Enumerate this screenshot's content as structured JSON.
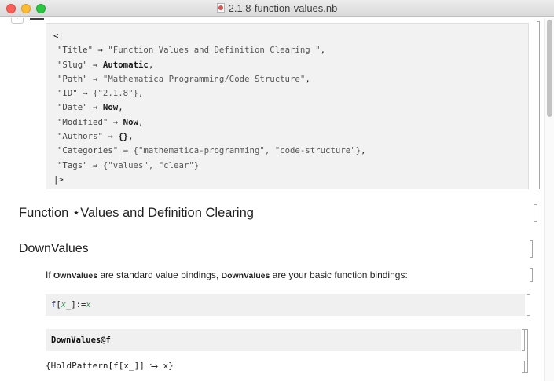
{
  "window": {
    "title": "2.1.8-function-values.nb"
  },
  "metadata_cell": {
    "open": "<|",
    "close": "|>",
    "rows": [
      {
        "key": "\"Title\"",
        "value": "\"Function Values and Definition Clearing \"",
        "kind": "str",
        "suffix": ","
      },
      {
        "key": "\"Slug\"",
        "value": "Automatic",
        "kind": "sym",
        "suffix": ","
      },
      {
        "key": "\"Path\"",
        "value": "\"Mathematica Programming/Code Structure\"",
        "kind": "str",
        "suffix": ","
      },
      {
        "key": "\"ID\"",
        "value": "{\"2.1.8\"}",
        "kind": "str",
        "suffix": ","
      },
      {
        "key": "\"Date\"",
        "value": "Now",
        "kind": "sym",
        "suffix": ","
      },
      {
        "key": "\"Modified\"",
        "value": "Now",
        "kind": "sym",
        "suffix": ","
      },
      {
        "key": "\"Authors\"",
        "value": "{}",
        "kind": "sym",
        "suffix": ","
      },
      {
        "key": "\"Categories\"",
        "value": "{\"mathematica-programming\", \"code-structure\"}",
        "kind": "str",
        "suffix": ","
      },
      {
        "key": "\"Tags\"",
        "value": "{\"values\", \"clear\"}",
        "kind": "str",
        "suffix": ""
      }
    ],
    "arrow": "→"
  },
  "section_title": "Function ⋆Values and Definition Clearing",
  "subsection_title": "DownValues",
  "text_cell": {
    "prefix": "If ",
    "term1": "OwnValues",
    "middle": " are standard value bindings, ",
    "term2": "DownValues",
    "suffix": " are your basic function bindings:"
  },
  "input1": {
    "f": "f",
    "open": "[",
    "x": "x_",
    "close": "]:=",
    "rhs": "x"
  },
  "input2": {
    "head": "DownValues@",
    "arg": "f"
  },
  "output1": "{HoldPattern[f[x_]] ⧴ x}"
}
